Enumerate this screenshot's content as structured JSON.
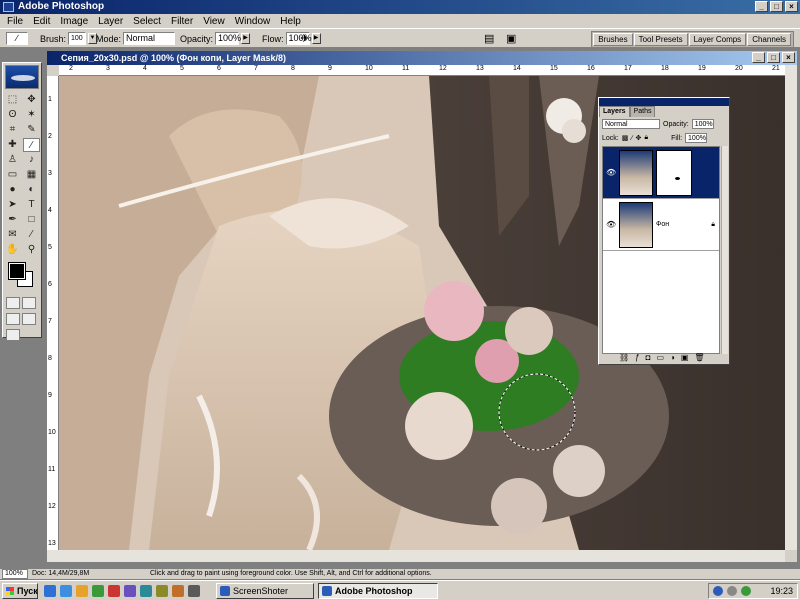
{
  "app": {
    "title": "Adobe Photoshop",
    "window_buttons": [
      "_",
      "□",
      "×"
    ]
  },
  "menu": [
    "File",
    "Edit",
    "Image",
    "Layer",
    "Select",
    "Filter",
    "View",
    "Window",
    "Help"
  ],
  "options": {
    "brush_label": "Brush:",
    "brush_size": "100",
    "mode_label": "Mode:",
    "mode_value": "Normal",
    "opacity_label": "Opacity:",
    "opacity_value": "100%",
    "flow_label": "Flow:",
    "flow_value": "100%"
  },
  "palette_well": [
    "Brushes",
    "Tool Presets",
    "Layer Comps",
    "Channels"
  ],
  "document": {
    "title": "Сепия_20x30.psd @ 100% (Фон копи, Layer Mask/8)",
    "ruler_top": [
      "2",
      "3",
      "4",
      "5",
      "6",
      "7",
      "8",
      "9",
      "10",
      "11",
      "12",
      "13",
      "14",
      "15",
      "16",
      "17",
      "18",
      "19",
      "20",
      "21"
    ],
    "ruler_left": [
      "1",
      "2",
      "3",
      "4",
      "5",
      "6",
      "7",
      "8",
      "9",
      "10",
      "11",
      "12",
      "13"
    ]
  },
  "layers_palette": {
    "tabs": [
      "Layers",
      "Paths"
    ],
    "blend_mode": "Normal",
    "opacity_label": "Opacity:",
    "opacity_value": "100%",
    "lock_label": "Lock:",
    "fill_label": "Fill:",
    "fill_value": "100%",
    "layers": [
      {
        "name": "",
        "selected": true,
        "has_mask": true
      },
      {
        "name": "Фон",
        "selected": false,
        "locked": true
      }
    ]
  },
  "status": {
    "zoom": "100%",
    "doc": "Doc: 14,4M/29,8M",
    "hint": "Click and drag to paint using foreground color.  Use Shift, Alt, and Ctrl for additional options."
  },
  "taskbar": {
    "start": "Пуск",
    "tasks": [
      "ScreenShoter",
      "Adobe Photoshop"
    ],
    "clock": "19:23"
  },
  "colors": {
    "titlebar": "#0a246a",
    "chrome": "#d4d0c8",
    "sepia": "#c9b7a4"
  }
}
